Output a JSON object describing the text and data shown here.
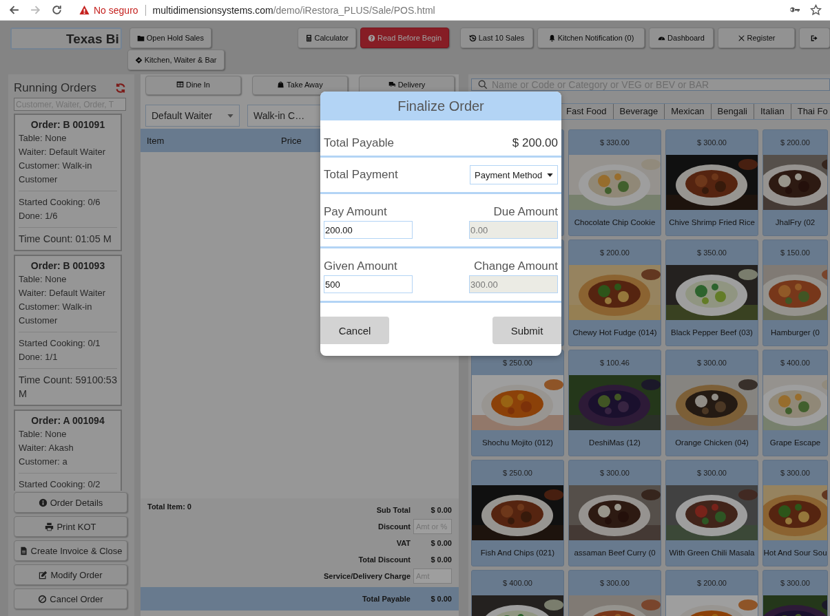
{
  "browser": {
    "security": "No seguro",
    "host": "multidimensionsystems.com",
    "path": "/demo/iRestora_PLUS/Sale/POS.html"
  },
  "header": {
    "outlet": "Texas Bi",
    "left_buttons": [
      {
        "label": "Open Hold Sales"
      },
      {
        "label": "Kitchen, Waiter & Bar"
      }
    ],
    "right_buttons": [
      {
        "label": "Calculator",
        "kind": "default"
      },
      {
        "label": "Read Before Begin",
        "kind": "danger"
      },
      {
        "label": "Last 10 Sales",
        "kind": "default"
      },
      {
        "label": "Kitchen Notification (0)",
        "kind": "default"
      },
      {
        "label": "Dashboard",
        "kind": "default"
      },
      {
        "label": "Register",
        "kind": "default"
      }
    ]
  },
  "running_orders": {
    "title": "Running Orders",
    "search_placeholder": "Customer, Waiter, Order, T",
    "orders": [
      {
        "title": "Order: B 001091",
        "details": [
          "Table: None",
          "Waiter: Default Waiter",
          "Customer: Walk-in Customer"
        ],
        "progress": [
          "Started Cooking: 0/6",
          "Done: 1/6"
        ],
        "time": "Time Count: 01:05 M"
      },
      {
        "title": "Order: B 001093",
        "details": [
          "Table: None",
          "Waiter: Default Waiter",
          "Customer: Walk-in Customer"
        ],
        "progress": [
          "Started Cooking: 0/1",
          "Done: 1/1"
        ],
        "time": "Time Count: 59100:53 M"
      },
      {
        "title": "Order: A 001094",
        "details": [
          "Table: None",
          "Waiter: Akash",
          "Customer: a"
        ],
        "progress": [
          "Started Cooking: 0/2"
        ]
      }
    ],
    "actions": [
      "Order Details",
      "Print KOT",
      "Create Invoice & Close",
      "Modify Order",
      "Cancel Order"
    ]
  },
  "order_panel": {
    "order_types": [
      "Dine In",
      "Take Away",
      "Delivery"
    ],
    "selects": [
      "Default Waiter",
      "Walk-in C…"
    ],
    "columns": [
      "Item",
      "Price"
    ],
    "total_items": "Total Item: 0",
    "totals": [
      {
        "label": "Sub Total",
        "value": "$ 0.00",
        "kind": "value"
      },
      {
        "label": "Discount",
        "placeholder": "Amt or %",
        "kind": "input"
      },
      {
        "label": "VAT",
        "value": "$ 0.00",
        "kind": "value"
      },
      {
        "label": "Total Discount",
        "value": "$ 0.00",
        "kind": "value"
      },
      {
        "label": "Service/Delivery Charge",
        "placeholder": "Amt",
        "kind": "input"
      }
    ],
    "total_payable": {
      "label": "Total Payable",
      "value": "$ 0.00"
    }
  },
  "menu": {
    "search_placeholder": "Name or Code or Category or VEG or BEV or BAR",
    "categories": [
      "Fast Food",
      "Beverage",
      "Mexican",
      "Bengali",
      "Italian",
      "Thai Fo"
    ],
    "items": [
      {
        "kind": "covered"
      },
      {
        "kind": "item",
        "price": "$ 330.00",
        "name": "Chocolate Chip Cookie"
      },
      {
        "kind": "item",
        "price": "$ 300.00",
        "name": "Chive Shrimp Fried Rice"
      },
      {
        "kind": "item",
        "price": "$ 200.00",
        "name": "JhalFry (02"
      },
      {
        "kind": "covered"
      },
      {
        "kind": "item",
        "price": "$ 200.00",
        "name": "Chewy Hot Fudge (014)"
      },
      {
        "kind": "item",
        "price": "$ 350.00",
        "name": "Black Pepper Beef (03)"
      },
      {
        "kind": "item",
        "price": "$ 150.00",
        "name": "Hamburger (0"
      },
      {
        "kind": "item",
        "price": "$ 250.00",
        "name": "Shochu Mojito (012)"
      },
      {
        "kind": "item",
        "price": "$ 100.46",
        "name": "DeshiMas (12)"
      },
      {
        "kind": "item",
        "price": "$ 300.00",
        "name": "Orange Chicken (04)"
      },
      {
        "kind": "item",
        "price": "$ 400.00",
        "name": "Grape Escape"
      },
      {
        "kind": "item",
        "price": "$ 250.00",
        "name": "Fish And Chips (021)"
      },
      {
        "kind": "item",
        "price": "$ 300.00",
        "name": "assaman Beef Curry (0"
      },
      {
        "kind": "item",
        "price": "$ 300.00",
        "name": "With Green Chili Masala"
      },
      {
        "kind": "item",
        "price": "$ 300.00",
        "name": "Hot And Sour Sou"
      },
      {
        "kind": "item",
        "price": "$ 400.00"
      },
      {
        "kind": "item",
        "price": "$ 300.00"
      },
      {
        "kind": "item",
        "price": "$ 200.00"
      },
      {
        "kind": "item",
        "price": "$ 300.00"
      }
    ]
  },
  "modal": {
    "title": "Finalize Order",
    "total_payable": {
      "label": "Total Payable",
      "value": "$ 200.00"
    },
    "total_payment": {
      "label": "Total Payment",
      "select": "Payment Method"
    },
    "amount_rows": [
      [
        {
          "label": "Pay Amount",
          "value": "200.00",
          "disabled": false
        },
        {
          "label": "Due Amount",
          "value": "0.00",
          "disabled": true
        }
      ],
      [
        {
          "label": "Given Amount",
          "value": "500",
          "disabled": false
        },
        {
          "label": "Change Amount",
          "value": "300.00",
          "disabled": true
        }
      ]
    ],
    "buttons": [
      "Cancel",
      "Submit"
    ]
  }
}
